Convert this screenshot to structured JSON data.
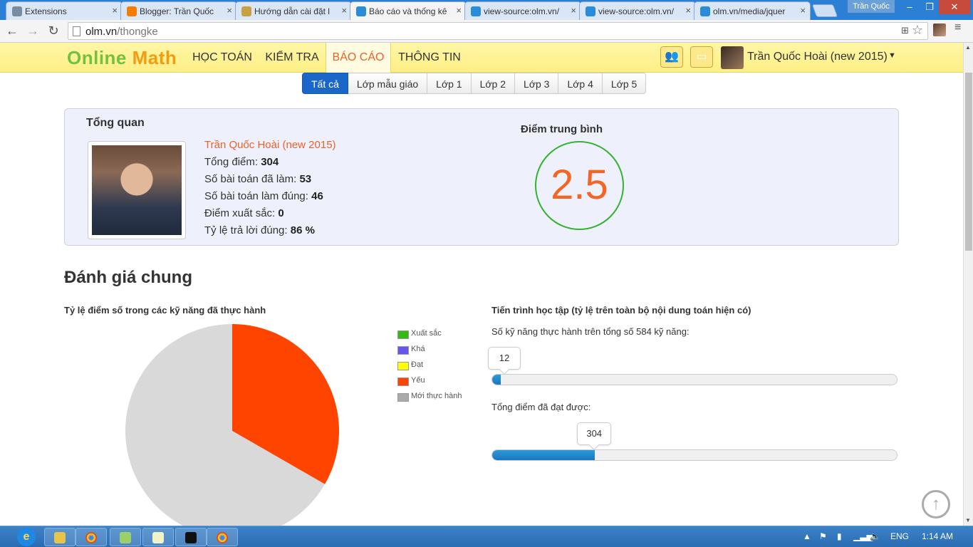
{
  "browser": {
    "tabs": [
      {
        "title": "Extensions",
        "icon": "puzzle-icon",
        "color": "#7a8aa0"
      },
      {
        "title": "Blogger: Trần Quốc",
        "icon": "blogger-icon",
        "color": "#f57c00"
      },
      {
        "title": "Hướng dẫn cài đặt l",
        "icon": "site-icon",
        "color": "#c8a040"
      },
      {
        "title": "Báo cáo và thống kê",
        "icon": "cloud-icon",
        "color": "#2a8bd8",
        "active": true
      },
      {
        "title": "view-source:olm.vn/",
        "icon": "cloud-icon",
        "color": "#2a8bd8"
      },
      {
        "title": "view-source:olm.vn/",
        "icon": "cloud-icon",
        "color": "#2a8bd8"
      },
      {
        "title": "olm.vn/media/jquer",
        "icon": "cloud-icon",
        "color": "#2a8bd8"
      }
    ],
    "tab_close": "×",
    "profile_name": "Trần Quốc",
    "url_host": "olm.vn",
    "url_path": "/thongke",
    "win_min": "–",
    "win_max": "❐",
    "win_close": "✕"
  },
  "header": {
    "logo_part1": "Online",
    "logo_part2": "Math",
    "nav": [
      "HỌC TOÁN",
      "KIỂM TRA",
      "BÁO CÁO",
      "THÔNG TIN"
    ],
    "active_nav": "BÁO CÁO",
    "user_name": "Trần Quốc Hoài (new 2015)"
  },
  "grades": [
    "Tất cả",
    "Lớp mẫu giáo",
    "Lớp 1",
    "Lớp 2",
    "Lớp 3",
    "Lớp 4",
    "Lớp 5"
  ],
  "overview": {
    "title": "Tổng quan",
    "name": "Trần Quốc Hoài (new 2015)",
    "total_points_label": "Tổng điểm:",
    "total_points": "304",
    "problems_done_label": "Số bài toán đã làm:",
    "problems_done": "53",
    "problems_correct_label": "Số bài toán làm đúng:",
    "problems_correct": "46",
    "excellent_label": "Điểm xuất sắc:",
    "excellent": "0",
    "accuracy_label": "Tỷ lệ trả lời đúng:",
    "accuracy": "86 %",
    "avg_title": "Điểm trung bình",
    "avg_value": "2.5"
  },
  "evaluation": {
    "heading": "Đánh giá chung",
    "pie_title": "Tỷ lệ điểm số trong các kỹ năng đã thực hành",
    "progress_title": "Tiến trình học tập (tỷ lệ trên toàn bộ nội dung toán hiện có)",
    "skills_label": "Số kỹ năng thực hành trên tổng số 584 kỹ năng:",
    "skills_value": "12",
    "skills_fraction": 0.0205,
    "points_label": "Tổng điểm đã đạt được:",
    "points_value": "304",
    "points_fraction": 0.253
  },
  "chart_data": {
    "type": "pie",
    "title": "Tỷ lệ điểm số trong các kỹ năng đã thực hành",
    "legend": [
      "Xuất sắc",
      "Khá",
      "Đạt",
      "Yếu",
      "Mới thực hành"
    ],
    "values": [
      0,
      0,
      0,
      33.3,
      66.7
    ],
    "colors": [
      "#33bb11",
      "#6655ee",
      "#ffff00",
      "#ff4400",
      "#aaaaaa"
    ],
    "legend_placement": "right"
  },
  "taskbar": {
    "lang": "ENG",
    "time": "1:14 AM"
  }
}
